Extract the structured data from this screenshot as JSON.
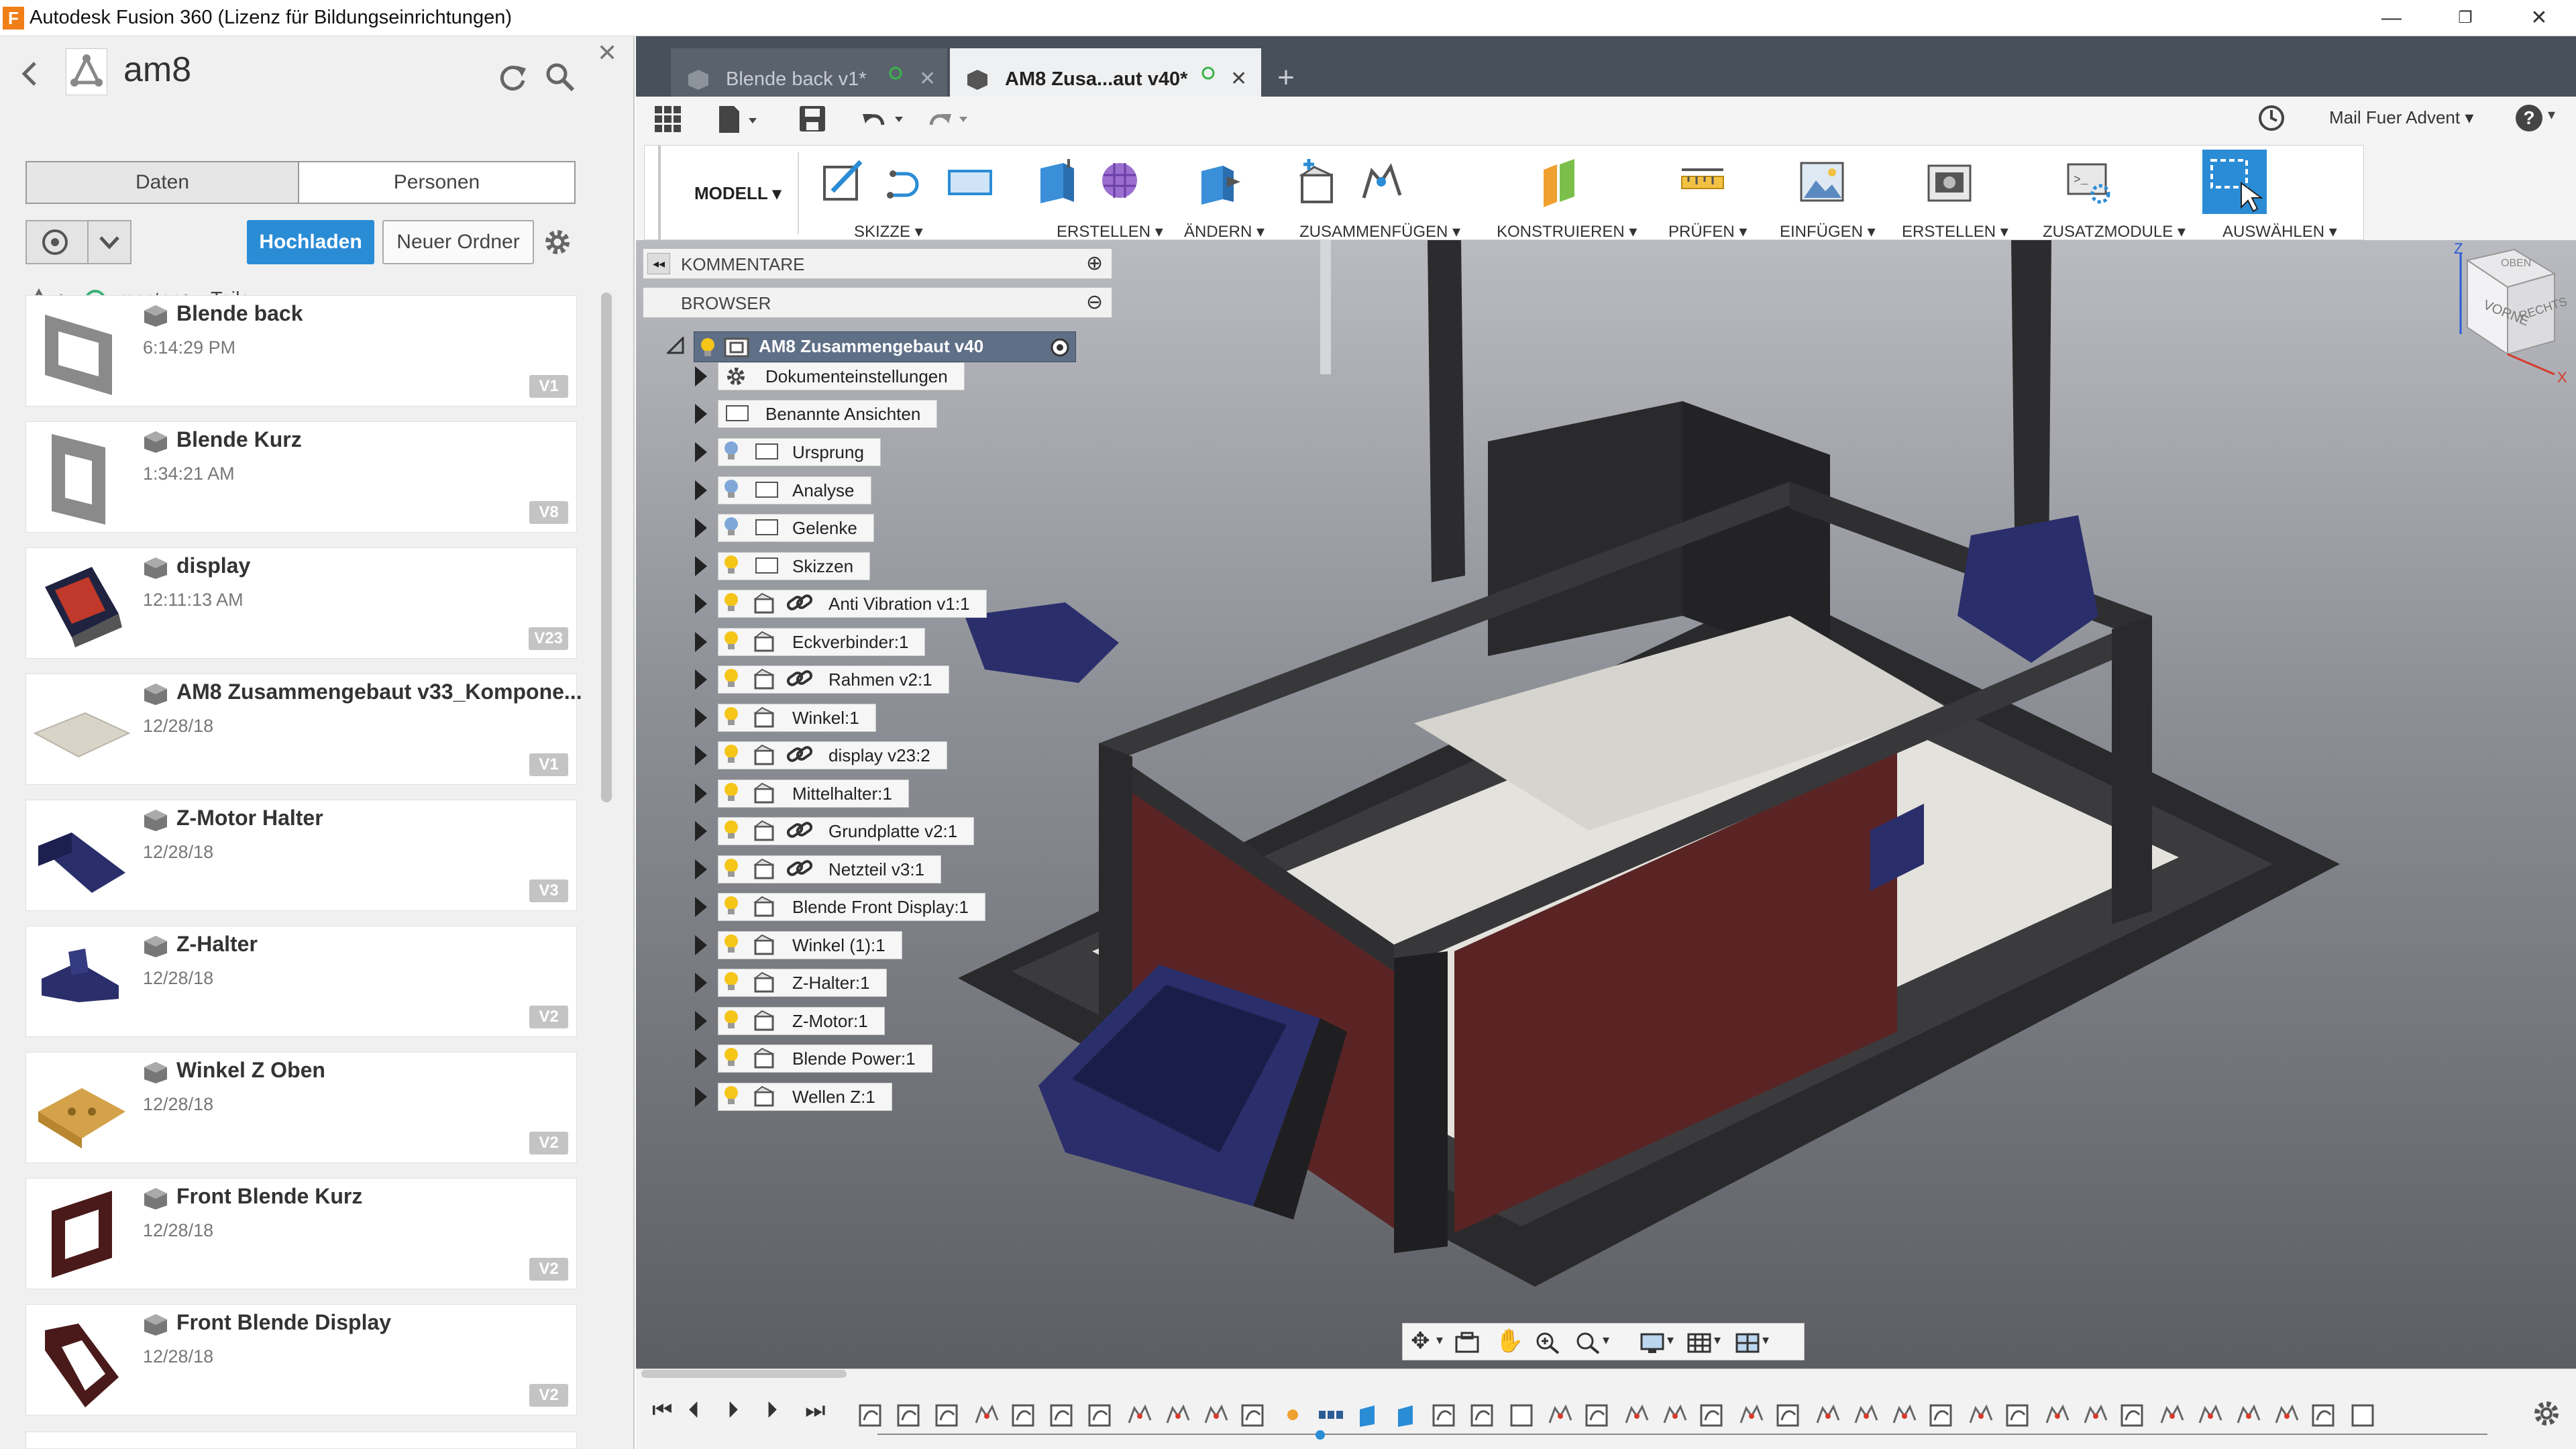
{
  "window": {
    "title": "Autodesk Fusion 360 (Lizenz für Bildungseinrichtungen)",
    "logo_letter": "F",
    "minimize": "—",
    "restore": "❐",
    "close": "✕"
  },
  "datapanel": {
    "project_name": "am8",
    "close": "✕",
    "tabs": [
      "Daten",
      "Personen"
    ],
    "active_tab": 0,
    "upload_button": "Hochladen",
    "new_folder_button": "Neuer Ordner",
    "breadcrumb": [
      "master",
      "Teile"
    ],
    "files": [
      {
        "name": "Blende back",
        "date": "6:14:29 PM",
        "version": "V1"
      },
      {
        "name": "Blende Kurz",
        "date": "1:34:21 AM",
        "version": "V8"
      },
      {
        "name": "display",
        "date": "12:11:13 AM",
        "version": "V23"
      },
      {
        "name": "AM8 Zusammengebaut v33_Kompone...",
        "date": "12/28/18",
        "version": "V1"
      },
      {
        "name": "Z-Motor Halter",
        "date": "12/28/18",
        "version": "V3"
      },
      {
        "name": "Z-Halter",
        "date": "12/28/18",
        "version": "V2"
      },
      {
        "name": "Winkel Z Oben",
        "date": "12/28/18",
        "version": "V2"
      },
      {
        "name": "Front Blende Kurz",
        "date": "12/28/18",
        "version": "V2"
      },
      {
        "name": "Front Blende Display",
        "date": "12/28/18",
        "version": "V2"
      }
    ]
  },
  "doc_tabs": [
    {
      "label": "Blende back v1*",
      "active": false
    },
    {
      "label": "AM8 Zusa...aut v40*",
      "active": true
    }
  ],
  "doc_tab_add": "+",
  "user_menu": "Mail Fuer Advent",
  "help": "?",
  "ribbon": {
    "workspace": "MODELL",
    "groups": [
      "SKIZZE",
      "ERSTELLEN",
      "ÄNDERN",
      "ZUSAMMENFÜGEN",
      "KONSTRUIEREN",
      "PRÜFEN",
      "EINFÜGEN",
      "ERSTELLEN",
      "ZUSATZMODULE",
      "AUSWÄHLEN"
    ]
  },
  "viewcube": {
    "front": "VORNE",
    "right": "RECHTS",
    "top": "OBEN",
    "axis_z": "Z",
    "axis_x": "X"
  },
  "browser": {
    "comments_header": "KOMMENTARE",
    "browser_header": "BROWSER",
    "root": "AM8 Zusammengebaut v40",
    "items": [
      {
        "label": "Dokumenteinstellungen",
        "kind": "settings"
      },
      {
        "label": "Benannte Ansichten",
        "kind": "folder"
      },
      {
        "label": "Ursprung",
        "kind": "folder",
        "bulb": "off"
      },
      {
        "label": "Analyse",
        "kind": "folder",
        "bulb": "off"
      },
      {
        "label": "Gelenke",
        "kind": "folder",
        "bulb": "off"
      },
      {
        "label": "Skizzen",
        "kind": "folder",
        "bulb": "on"
      },
      {
        "label": "Anti Vibration v1:1",
        "kind": "linked",
        "bulb": "on"
      },
      {
        "label": "Eckverbinder:1",
        "kind": "component",
        "bulb": "on"
      },
      {
        "label": "Rahmen v2:1",
        "kind": "linked",
        "bulb": "on"
      },
      {
        "label": "Winkel:1",
        "kind": "component",
        "bulb": "on"
      },
      {
        "label": "display v23:2",
        "kind": "linked",
        "bulb": "on"
      },
      {
        "label": "Mittelhalter:1",
        "kind": "component",
        "bulb": "on"
      },
      {
        "label": "Grundplatte v2:1",
        "kind": "linked",
        "bulb": "on"
      },
      {
        "label": "Netzteil v3:1",
        "kind": "linked",
        "bulb": "on"
      },
      {
        "label": "Blende Front Display:1",
        "kind": "component",
        "bulb": "on"
      },
      {
        "label": "Winkel (1):1",
        "kind": "component",
        "bulb": "on"
      },
      {
        "label": "Z-Halter:1",
        "kind": "component",
        "bulb": "on"
      },
      {
        "label": "Z-Motor:1",
        "kind": "component",
        "bulb": "on"
      },
      {
        "label": "Blende Power:1",
        "kind": "component",
        "bulb": "on"
      },
      {
        "label": "Wellen Z:1",
        "kind": "component",
        "bulb": "on"
      }
    ]
  },
  "colors": {
    "accent_blue": "#2b8cd6",
    "tab_bar": "#48505c",
    "bulb_on": "#f5c518",
    "bulb_off": "#7fa8d8",
    "frame_dark": "#2c2c2e",
    "panel_red": "#5a2424",
    "part_blue": "#2a2f6b"
  }
}
